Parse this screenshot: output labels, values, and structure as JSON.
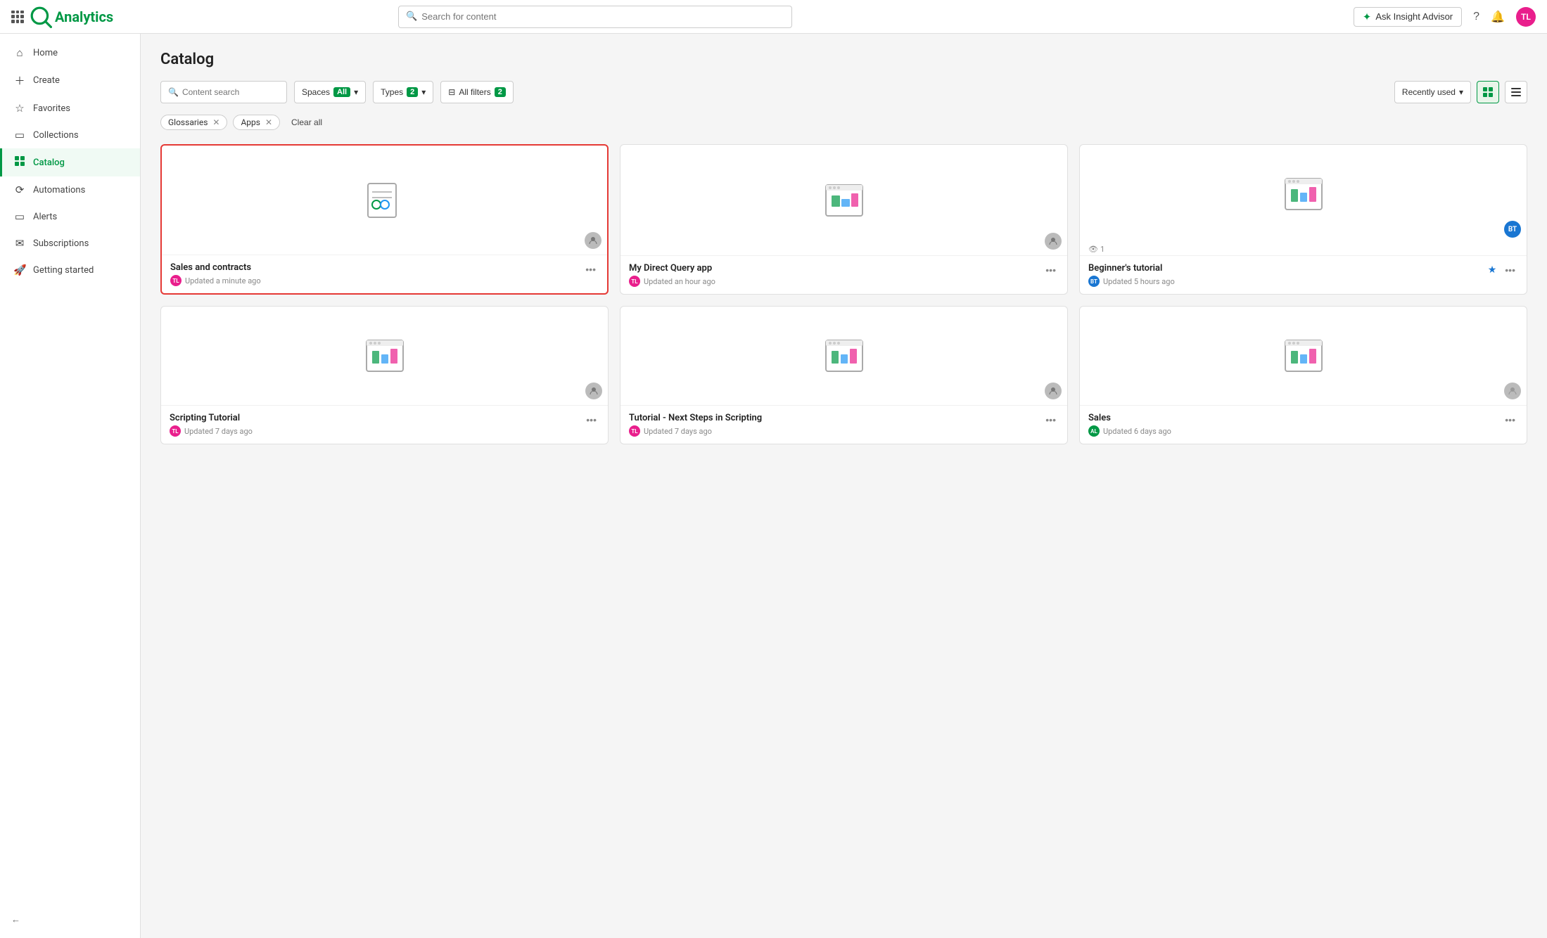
{
  "topnav": {
    "logo_text": "Qlik",
    "app_name": "Analytics",
    "search_placeholder": "Search for content",
    "insight_btn_label": "Ask Insight Advisor",
    "avatar_initials": "TL"
  },
  "sidebar": {
    "items": [
      {
        "id": "home",
        "label": "Home",
        "icon": "home"
      },
      {
        "id": "create",
        "label": "Create",
        "icon": "plus"
      },
      {
        "id": "favorites",
        "label": "Favorites",
        "icon": "star"
      },
      {
        "id": "collections",
        "label": "Collections",
        "icon": "collections"
      },
      {
        "id": "catalog",
        "label": "Catalog",
        "icon": "catalog",
        "active": true
      },
      {
        "id": "automations",
        "label": "Automations",
        "icon": "automations"
      },
      {
        "id": "alerts",
        "label": "Alerts",
        "icon": "alerts"
      },
      {
        "id": "subscriptions",
        "label": "Subscriptions",
        "icon": "subscriptions"
      },
      {
        "id": "getting-started",
        "label": "Getting started",
        "icon": "rocket"
      }
    ],
    "collapse_label": "Collapse"
  },
  "main": {
    "page_title": "Catalog",
    "toolbar": {
      "content_search_placeholder": "Content search",
      "spaces_label": "Spaces",
      "spaces_value": "All",
      "types_label": "Types",
      "types_count": "2",
      "filters_label": "All filters",
      "filters_count": "2",
      "sort_label": "Recently used",
      "view_grid_label": "Grid view",
      "view_list_label": "List view"
    },
    "filter_tags": [
      {
        "label": "Glossaries"
      },
      {
        "label": "Apps"
      }
    ],
    "clear_all_label": "Clear all",
    "cards": [
      {
        "id": "sales-contracts",
        "title": "Sales and contracts",
        "meta": "Updated a minute ago",
        "avatar_color": "#e91e8c",
        "avatar_initials": "TL",
        "icon_type": "glossary",
        "selected": true,
        "views": null,
        "starred": false
      },
      {
        "id": "my-direct-query",
        "title": "My Direct Query app",
        "meta": "Updated an hour ago",
        "avatar_color": "#e91e8c",
        "avatar_initials": "TL",
        "icon_type": "app",
        "selected": false,
        "views": null,
        "starred": false
      },
      {
        "id": "beginners-tutorial",
        "title": "Beginner's tutorial",
        "meta": "Updated 5 hours ago",
        "avatar_color": "#1976d2",
        "avatar_initials": "BT",
        "icon_type": "app",
        "selected": false,
        "views": 1,
        "starred": true
      },
      {
        "id": "scripting-tutorial",
        "title": "Scripting Tutorial",
        "meta": "Updated 7 days ago",
        "avatar_color": "#e91e8c",
        "avatar_initials": "TL",
        "icon_type": "app",
        "selected": false,
        "views": null,
        "starred": false
      },
      {
        "id": "tutorial-next-steps",
        "title": "Tutorial - Next Steps in Scripting",
        "meta": "Updated 7 days ago",
        "avatar_color": "#e91e8c",
        "avatar_initials": "TL",
        "icon_type": "app",
        "selected": false,
        "views": null,
        "starred": false
      },
      {
        "id": "sales",
        "title": "Sales",
        "meta": "Updated 6 days ago",
        "avatar_color": "#009845",
        "avatar_initials": "AL",
        "icon_type": "app",
        "selected": false,
        "views": null,
        "starred": false
      }
    ]
  }
}
